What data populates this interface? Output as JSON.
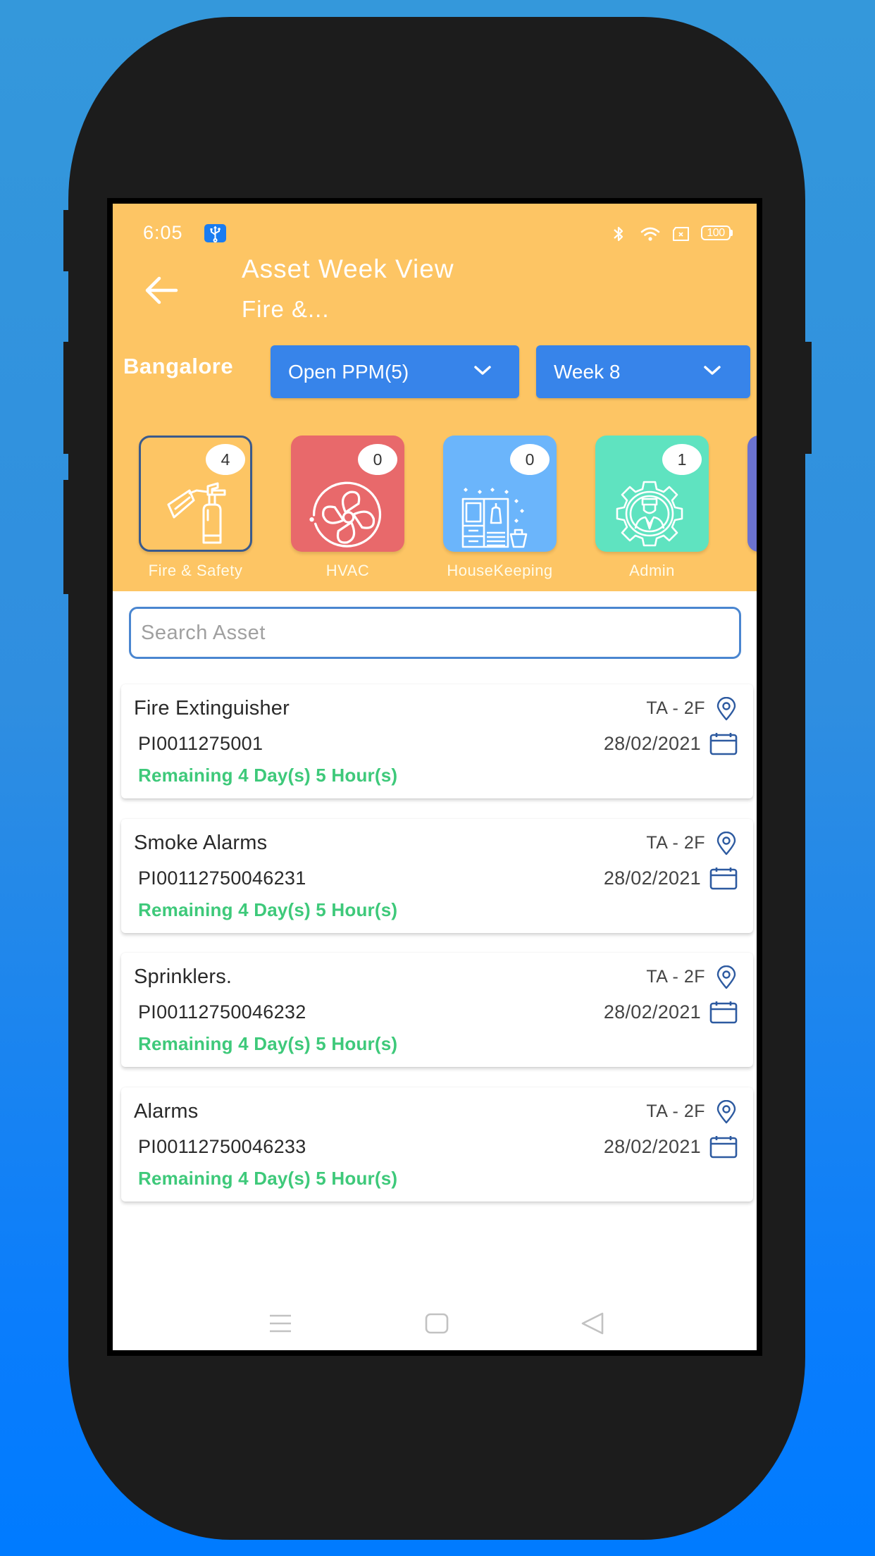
{
  "status_bar": {
    "time": "6:05",
    "notification_icon": "usb-icon",
    "right_icons": [
      "bluetooth-icon",
      "wifi-icon",
      "no-sim-icon",
      "battery-icon"
    ],
    "battery_level": "100"
  },
  "header": {
    "back_icon": "arrow-left-icon",
    "title": "Asset Week View",
    "subtitle": "Fire &...",
    "city": "Bangalore",
    "status_dropdown": {
      "selected": "Open PPM(5)"
    },
    "week_dropdown": {
      "selected": "Week 8"
    }
  },
  "categories": [
    {
      "label": "Fire & Safety",
      "count": "4",
      "icon": "fire-extinguisher-icon",
      "color": "#fdc564",
      "selected": true
    },
    {
      "label": "HVAC",
      "count": "0",
      "icon": "fan-icon",
      "color": "#e8696b",
      "selected": false
    },
    {
      "label": "HouseKeeping",
      "count": "0",
      "icon": "housekeeping-icon",
      "color": "#6bb5fb",
      "selected": false
    },
    {
      "label": "Admin",
      "count": "1",
      "icon": "admin-gear-icon",
      "color": "#5fe3c0",
      "selected": false
    },
    {
      "label": "",
      "count": "",
      "icon": "",
      "color": "#6b72d0",
      "selected": false
    }
  ],
  "search": {
    "placeholder": "Search Asset",
    "value": ""
  },
  "assets": [
    {
      "name": "Fire Extinguisher",
      "id": "PI0011275001",
      "location": "TA - 2F",
      "date": "28/02/2021",
      "remaining": "Remaining 4 Day(s) 5 Hour(s)"
    },
    {
      "name": "Smoke Alarms",
      "id": "PI00112750046231",
      "location": "TA - 2F",
      "date": "28/02/2021",
      "remaining": "Remaining 4 Day(s) 5 Hour(s)"
    },
    {
      "name": "Sprinklers.",
      "id": "PI00112750046232",
      "location": "TA - 2F",
      "date": "28/02/2021",
      "remaining": "Remaining 4 Day(s) 5 Hour(s)"
    },
    {
      "name": "Alarms",
      "id": "PI00112750046233",
      "location": "TA - 2F",
      "date": "28/02/2021",
      "remaining": "Remaining 4 Day(s) 5 Hour(s)"
    }
  ],
  "nav_bar": {
    "buttons": [
      "menu-icon",
      "home-icon",
      "back-triangle-icon"
    ]
  },
  "colors": {
    "header_bg": "#fdc564",
    "dropdown_bg": "#3784ea",
    "remaining_text": "#3ec97a",
    "icon_blue": "#2d5aa0",
    "search_border": "#4a86d0"
  }
}
